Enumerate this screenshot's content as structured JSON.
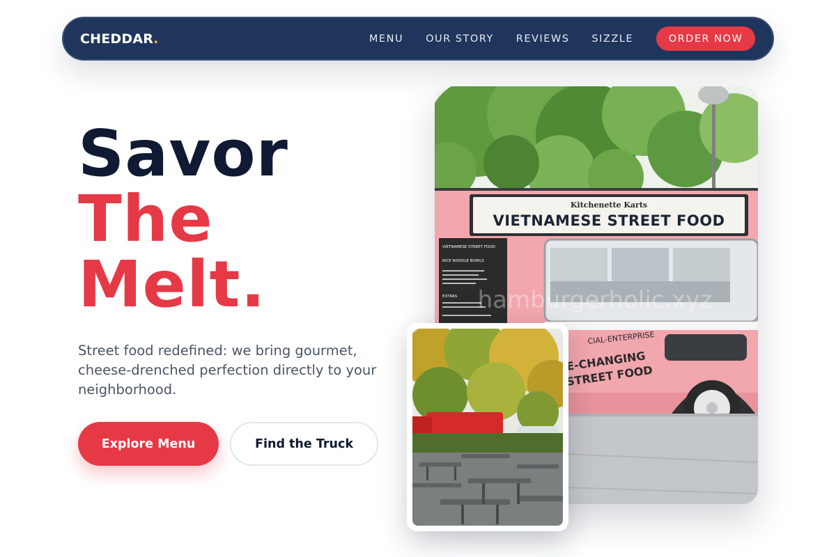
{
  "nav": {
    "brand": "CHEDDAR",
    "brand_dot": ".",
    "links": [
      "MENU",
      "OUR STORY",
      "REVIEWS",
      "SIZZLE"
    ],
    "cta": "ORDER NOW"
  },
  "hero": {
    "headline": [
      "Savor",
      "The",
      "Melt."
    ],
    "subtext": "Street food redefined: we bring gourmet, cheese-drenched perfection directly to your neighborhood.",
    "primary_button": "Explore Menu",
    "secondary_button": "Find the Truck"
  },
  "truck_image": {
    "sign_small": "Kitchenette Karts",
    "sign_large": "VIETNAMESE STREET FOOD",
    "side_text_1": "CIAL-ENTERPRISE",
    "side_text_2": "E-CHANGING",
    "side_text_3": "STREET FOOD",
    "menu_board_title": "VIETNAMESE STREET FOOD",
    "menu_board_section_1": "RICE NOODLE BOWLS",
    "menu_board_section_2": "EXTRAS",
    "watermark": "hamburgerholic.xyz"
  },
  "colors": {
    "navy": "#1f355b",
    "accent_red": "#e63946",
    "brand_dot_yellow": "#f4b930",
    "headline_dark": "#101a33",
    "body_text": "#4a5464",
    "truck_pink": "#f2a6ae"
  }
}
